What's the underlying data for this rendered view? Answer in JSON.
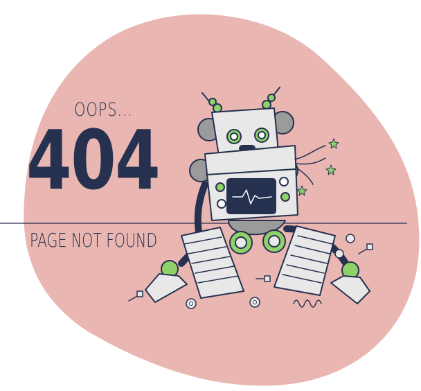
{
  "error": {
    "exclamation": "OOPS...",
    "code": "404",
    "message": "PAGE NOT FOUND"
  },
  "colors": {
    "blob": "#e9b6b2",
    "text": "#263150",
    "accent_green": "#8fd16a",
    "robot_light": "#e8e8e8",
    "robot_gray": "#9b9b9b",
    "outline": "#263150"
  }
}
